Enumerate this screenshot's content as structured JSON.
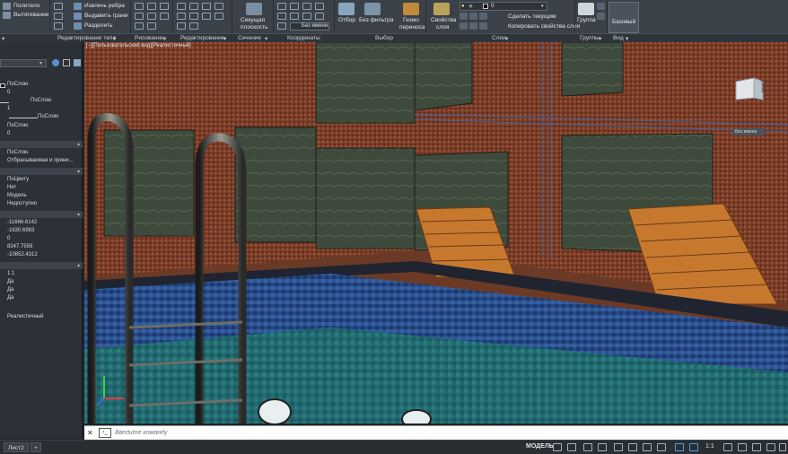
{
  "ribbon": {
    "polytelo": "Политело",
    "vytyagivanie": "Вытягивание",
    "izvlech_rebra": "Извлечь ребра",
    "vydavit_grani": "Выдавить грани",
    "razdelit": "Разделить",
    "sekushchaya": "Секущая",
    "ploskost": "плоскость",
    "otbor": "Отбор",
    "bez_filtra": "Без фильтра",
    "gizmo": "Гизмо",
    "perenosa": "переноса",
    "svoistva": "Свойства",
    "sloya": "слоя",
    "layer_value": "0",
    "sdelat_tekushchim": "Сделать текущим",
    "kopirovat_svoistva": "Копировать свойства слоя",
    "gruppa": "Группа",
    "bazovyi": "Базовый",
    "bez_imeni": "Без имени"
  },
  "panels": {
    "redakt_tela": "Редактирование тела",
    "risovanie": "Рисование",
    "redaktirovanie": "Редактирование",
    "sechenie": "Сечение",
    "koordinaty": "Координаты",
    "vybor": "Выбор",
    "sloi": "Слои",
    "gruppy": "Группы",
    "vid": "Вид"
  },
  "palette": {
    "rows": [
      {
        "text": "ПоСлою"
      },
      {
        "text": "0"
      },
      {
        "text": "ПоСлою"
      },
      {
        "text": "1"
      },
      {
        "text": "ПоСлою"
      },
      {
        "text": "ПоСлою"
      },
      {
        "text": "0"
      },
      {
        "text": "ПоСлою"
      },
      {
        "text": "Отбрасываемая и прини..."
      },
      {
        "text": "ПоЦвету"
      },
      {
        "text": "Нет"
      },
      {
        "text": "Модель"
      },
      {
        "text": "Недоступно"
      },
      {
        "text": "-11666.6142"
      },
      {
        "text": "-1630.6983"
      },
      {
        "text": "0"
      },
      {
        "text": "8247.7559"
      },
      {
        "text": "-10852.4312"
      },
      {
        "text": "1:1"
      },
      {
        "text": "Да"
      },
      {
        "text": "Да"
      },
      {
        "text": "Да"
      },
      {
        "text": "Реалистичный"
      }
    ]
  },
  "viewport": {
    "title": "[–][Пользовательский вид][Реалистичный]",
    "viewcube_face": "Слева",
    "wcs_label": "Без имени"
  },
  "command": {
    "placeholder": "Введите команду"
  },
  "statusbar": {
    "tab_layout2": "Лист2",
    "add_tab": "+",
    "model": "МОДЕЛЬ",
    "scale": "1:1"
  },
  "colors": {
    "brick": "#7a3d28",
    "tile_green": "#3e4a3b",
    "water": "#1f6f6a",
    "mosaic_blue": "#274a86",
    "wood": "#c7782f"
  }
}
